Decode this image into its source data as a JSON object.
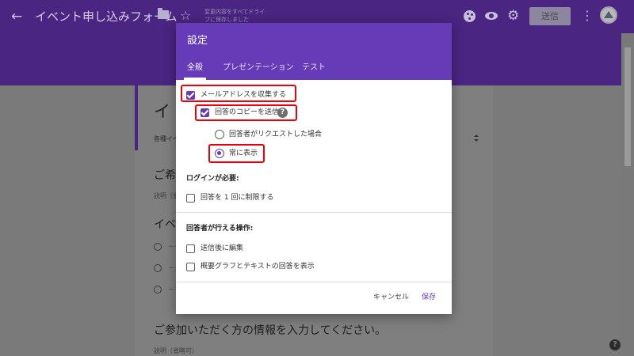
{
  "app_bar": {
    "back_glyph": "←",
    "title": "イベント申し込みフォーム",
    "star_glyph": "☆",
    "saved_status": "変更内容をすべてドライブに保存しました",
    "send_label": "送信",
    "more_glyph": "⋮",
    "gear_glyph": "⚙",
    "color": "#4a2581"
  },
  "form": {
    "title": "イベント申し込み",
    "title_visible": "イ",
    "description": "各種イベ",
    "q1_title": "ご希望",
    "q1_note": "説明（省",
    "q2_title": "イベン",
    "option_placeholder": "－－",
    "q3_title": "ご参加いただく方の情報を入力してください。",
    "q3_note": "説明（省略可）"
  },
  "dialog": {
    "title": "設定",
    "header_color": "#673ab7",
    "tabs": [
      {
        "label": "全般",
        "active": true
      },
      {
        "label": "プレゼンテーション",
        "active": false
      },
      {
        "label": "テスト",
        "active": false
      }
    ],
    "collect_email": {
      "label": "メールアドレスを収集する",
      "checked": true
    },
    "send_copy": {
      "label": "回答のコピーを送信",
      "checked": true,
      "help_glyph": "?"
    },
    "copy_options": [
      {
        "label": "回答者がリクエストした場合",
        "selected": false
      },
      {
        "label": "常に表示",
        "selected": true
      }
    ],
    "login_section": "ログインが必要:",
    "limit_one": {
      "label": "回答を 1 回に制限する",
      "checked": false
    },
    "respondent_section": "回答者が行える操作:",
    "edit_after": {
      "label": "送信後に編集",
      "checked": false
    },
    "summary_charts": {
      "label": "概要グラフとテキストの回答を表示",
      "checked": false
    },
    "cancel_label": "キャンセル",
    "save_label": "保存"
  },
  "help_fab_glyph": "?",
  "highlight_color": "#e8000b"
}
